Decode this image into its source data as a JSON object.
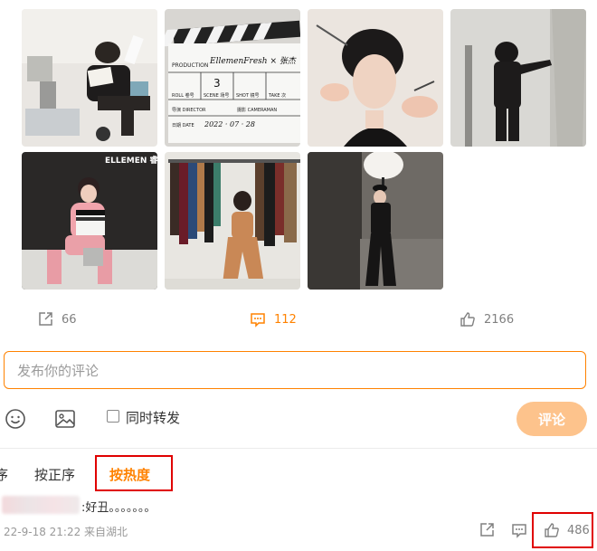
{
  "photos": [
    {
      "name": "photo-1",
      "alt": ""
    },
    {
      "name": "photo-2",
      "alt": ""
    },
    {
      "name": "photo-3",
      "alt": ""
    },
    {
      "name": "photo-4",
      "alt": ""
    },
    {
      "name": "photo-5",
      "alt": ""
    },
    {
      "name": "photo-6",
      "alt": ""
    },
    {
      "name": "photo-7",
      "alt": ""
    }
  ],
  "clapper": {
    "production_label": "PRODUCTION",
    "production_value": "EllemenFresh × 张杰",
    "roll_label": "ROLL 卷号",
    "scene_label": "SCENE 场号",
    "scene_value": "3",
    "shot_label": "SHOT 镜号",
    "take_label": "TAKE 次",
    "director_label": "导演 DIRECTOR",
    "camera_label": "摄影 CAMERAMAN",
    "date_label": "日期 DATE",
    "date_value": "2022 · 07 · 28"
  },
  "magazine_logo": "ELLEMEN 睿士",
  "actions": {
    "repost": {
      "icon": "share-icon",
      "count": "66"
    },
    "comment": {
      "icon": "comment-icon",
      "count": "112"
    },
    "like": {
      "icon": "thumbs-up-icon",
      "count": "2166"
    }
  },
  "composer": {
    "placeholder": "发布你的评论",
    "emoji_icon": "smiley-icon",
    "image_icon": "image-icon",
    "repost_label": "同时转发",
    "submit_label": "评论"
  },
  "sort": {
    "partial_label": "序",
    "tabs": [
      "按正序",
      "按热度"
    ],
    "active": "按热度"
  },
  "comment": {
    "text": ":好丑。。。。。。。",
    "meta": "22-9-18 21:22 来自湖北",
    "likes": "486"
  },
  "colors": {
    "accent": "#ff8200",
    "submit_disabled": "#fdc38c",
    "highlight_box": "#e00000"
  }
}
